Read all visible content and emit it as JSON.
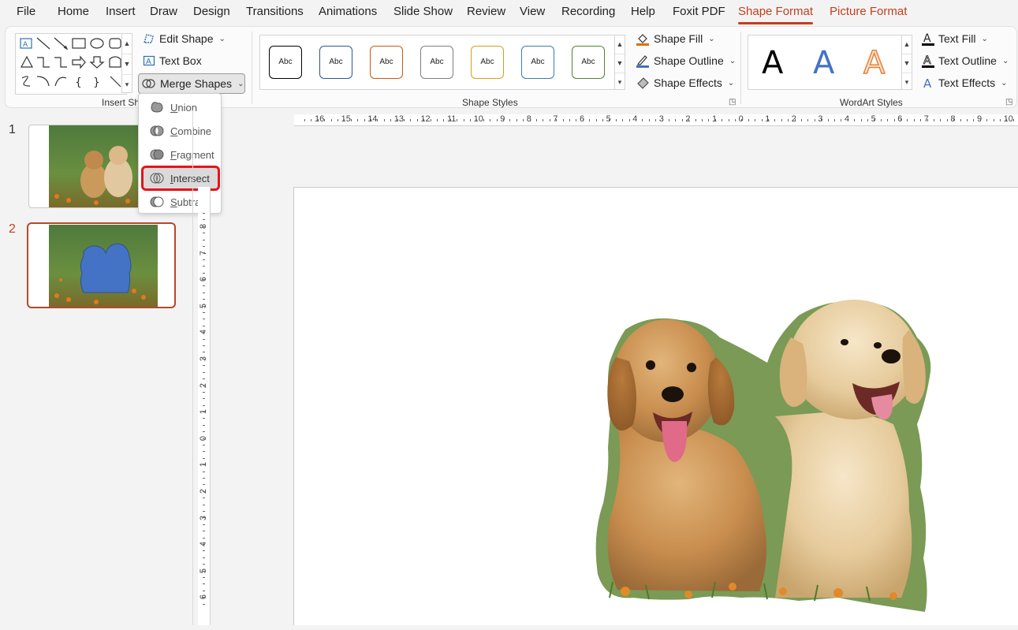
{
  "menu_tabs": [
    "File",
    "Home",
    "Insert",
    "Draw",
    "Design",
    "Transitions",
    "Animations",
    "Slide Show",
    "Review",
    "View",
    "Recording",
    "Help",
    "Foxit PDF",
    "Shape Format",
    "Picture Format"
  ],
  "active_tab": "Shape Format",
  "ribbon": {
    "insert_shapes": {
      "label": "Insert Shapes",
      "edit_shape": "Edit Shape",
      "text_box": "Text Box",
      "merge_shapes": "Merge Shapes"
    },
    "shape_styles": {
      "label": "Shape Styles",
      "swatches": [
        {
          "text": "Abc",
          "color": "#000000"
        },
        {
          "text": "Abc",
          "color": "#2f5597"
        },
        {
          "text": "Abc",
          "color": "#c55a11"
        },
        {
          "text": "Abc",
          "color": "#7f7f7f"
        },
        {
          "text": "Abc",
          "color": "#d4a017"
        },
        {
          "text": "Abc",
          "color": "#3d7ea6"
        },
        {
          "text": "Abc",
          "color": "#548235"
        }
      ],
      "shape_fill": "Shape Fill",
      "shape_outline": "Shape Outline",
      "shape_effects": "Shape Effects"
    },
    "wordart_styles": {
      "label": "WordArt Styles",
      "samples": [
        "A",
        "A",
        "A"
      ],
      "text_fill": "Text Fill",
      "text_outline": "Text Outline",
      "text_effects": "Text Effects"
    }
  },
  "merge_menu": {
    "items": [
      "Union",
      "Combine",
      "Fragment",
      "Intersect",
      "Subtract"
    ],
    "highlighted": "Intersect"
  },
  "slides": [
    {
      "number": "1"
    },
    {
      "number": "2",
      "selected": true
    }
  ],
  "rulers": {
    "horizontal": [
      "16",
      "15",
      "14",
      "13",
      "12",
      "11",
      "10",
      "9",
      "8",
      "7",
      "6",
      "5",
      "4",
      "3",
      "2",
      "1",
      "0",
      "1",
      "2",
      "3",
      "4",
      "5",
      "6",
      "7",
      "8",
      "9",
      "10"
    ],
    "vertical": [
      "8",
      "7",
      "6",
      "5",
      "4",
      "3",
      "2",
      "1",
      "0",
      "1",
      "2",
      "3",
      "4",
      "5",
      "6"
    ]
  },
  "colors": {
    "accent": "#c43e1c",
    "highlight_outline": "#e8121b",
    "merged_shape_fill": "#4472c4"
  }
}
